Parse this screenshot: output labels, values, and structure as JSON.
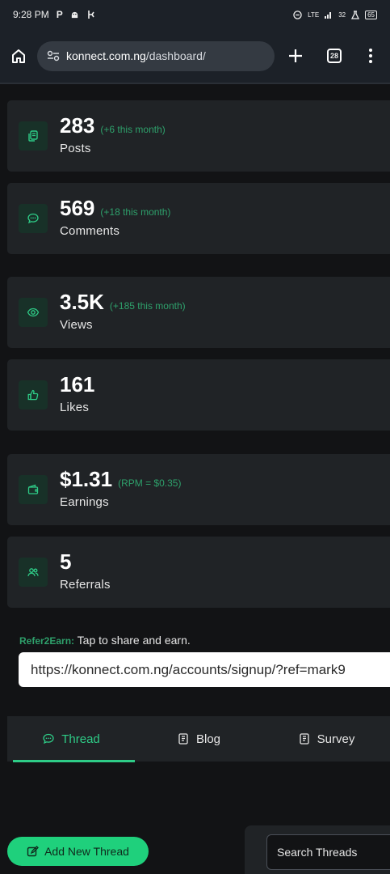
{
  "status_bar": {
    "time": "9:28 PM",
    "notif_icons": [
      "P",
      "android-icon",
      "data-saver-icon"
    ],
    "network": "LTE",
    "speed": "32",
    "battery": "65"
  },
  "browser": {
    "url_host": "konnect.com.ng",
    "url_path": "/dashboard/",
    "tab_count": "28"
  },
  "stats": [
    {
      "icon": "copy-icon",
      "value": "283",
      "delta": "(+6 this month)",
      "label": "Posts"
    },
    {
      "icon": "chat-bubble-icon",
      "value": "569",
      "delta": "(+18 this month)",
      "label": "Comments"
    },
    {
      "icon": "eye-icon",
      "value": "3.5K",
      "delta": "(+185 this month)",
      "label": "Views"
    },
    {
      "icon": "thumbs-up-icon",
      "value": "161",
      "delta": "",
      "label": "Likes"
    },
    {
      "icon": "wallet-icon",
      "value": "$1.31",
      "delta": "(RPM = $0.35)",
      "label": "Earnings"
    },
    {
      "icon": "users-icon",
      "value": "5",
      "delta": "",
      "label": "Referrals"
    }
  ],
  "refer": {
    "tag": "Refer2Earn:",
    "text": "Tap to share and earn.",
    "link": "https://konnect.com.ng/accounts/signup/?ref=mark9"
  },
  "tabs": [
    {
      "label": "Thread",
      "active": true
    },
    {
      "label": "Blog",
      "active": false
    },
    {
      "label": "Survey",
      "active": false
    }
  ],
  "add_button": "Add New Thread",
  "search_placeholder": "Search Threads",
  "colors": {
    "accent": "#2ecc87",
    "card": "#202326",
    "background": "#121315"
  }
}
